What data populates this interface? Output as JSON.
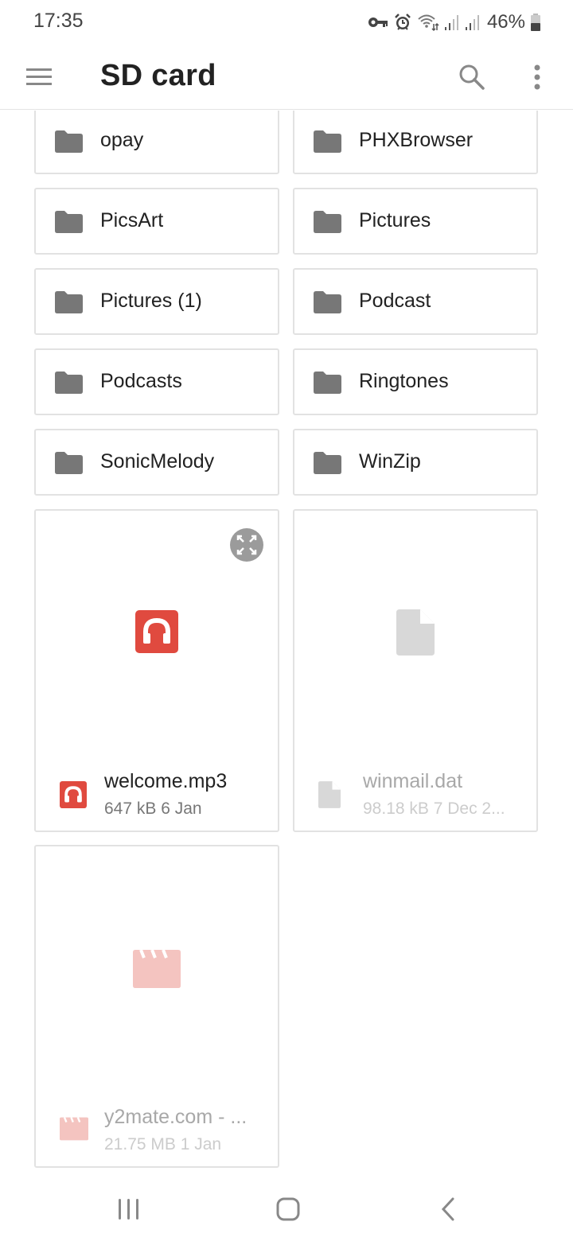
{
  "status_bar": {
    "time": "17:35",
    "icons": [
      "vpn-key-icon",
      "alarm-icon",
      "wifi-icon",
      "signal-icon",
      "signal-icon"
    ],
    "battery_percent": "46%"
  },
  "app_bar": {
    "title": "SD card",
    "menu_icon": "hamburger-menu-icon",
    "search_icon": "search-icon",
    "more_icon": "more-vert-icon"
  },
  "folders": [
    {
      "name": "opay"
    },
    {
      "name": "PHXBrowser"
    },
    {
      "name": "PicsArt"
    },
    {
      "name": "Pictures"
    },
    {
      "name": "Pictures (1)"
    },
    {
      "name": "Podcast"
    },
    {
      "name": "Podcasts"
    },
    {
      "name": "Ringtones"
    },
    {
      "name": "SonicMelody"
    },
    {
      "name": "WinZip"
    }
  ],
  "files": [
    {
      "name": "welcome.mp3",
      "meta": "647 kB 6 Jan",
      "type": "audio",
      "icon": "headphones-icon",
      "color": "#e04a3f"
    },
    {
      "name": "winmail.dat",
      "meta": "98.18 kB 7 Dec 2...",
      "type": "document",
      "icon": "file-icon",
      "color": "#d8d8d8"
    },
    {
      "name": "y2mate.com - ...",
      "meta": "21.75 MB 1 Jan",
      "type": "video",
      "icon": "clapperboard-icon",
      "color": "#f4c4c0"
    }
  ],
  "nav_bar": {
    "recents": "recents-icon",
    "home": "home-icon",
    "back": "back-icon"
  }
}
